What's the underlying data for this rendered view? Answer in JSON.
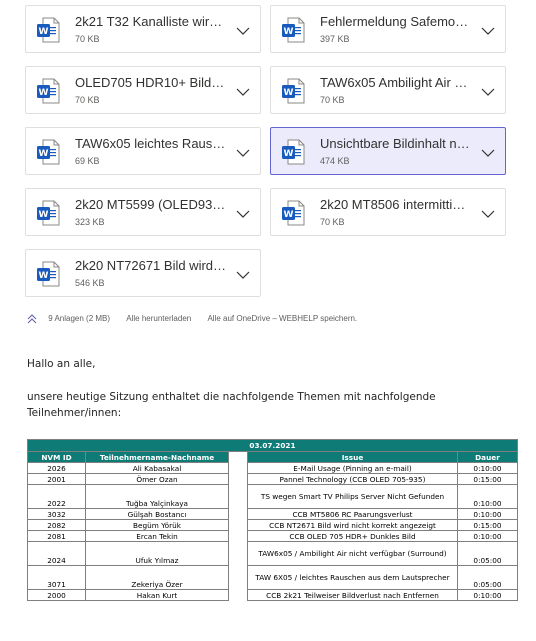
{
  "attachments": [
    {
      "name": "2k21 T32 Kanalliste wird …",
      "size": "70 KB",
      "selected": false
    },
    {
      "name": "Fehlermeldung Safemod…",
      "size": "397 KB",
      "selected": false
    },
    {
      "name": "OLED705 HDR10+ Bildin…",
      "size": "70 KB",
      "selected": false
    },
    {
      "name": "TAW6x05 Ambilight Air n…",
      "size": "70 KB",
      "selected": false
    },
    {
      "name": "TAW6x05 leichtes Rausc…",
      "size": "69 KB",
      "selected": false
    },
    {
      "name": "Unsichtbare Bildinhalt na…",
      "size": "474 KB",
      "selected": true
    },
    {
      "name": "2k20 MT5599 (OLED935)…",
      "size": "323 KB",
      "selected": false
    },
    {
      "name": "2k20 MT8506 intermittie…",
      "size": "70 KB",
      "selected": false
    },
    {
      "name": "2k20 NT72671 Bild wird …",
      "size": "546 KB",
      "selected": false
    }
  ],
  "attachment_bar": {
    "count_label": "9 Anlagen (2 MB)",
    "download_all": "Alle herunterladen",
    "save_onedrive": "Alle auf OneDrive – WEBHELP speichern."
  },
  "message": {
    "greeting": "Hallo an alle,",
    "line1": "unsere heutige Sitzung enthaltet die nachfolgende Themen mit nachfolgende",
    "line2": "Teilnehmer/innen:"
  },
  "table": {
    "date": "03.07.2021",
    "headers": {
      "id": "NVM ID",
      "name": "Teilnehmername-Nachname",
      "issue": "Issue",
      "duration": "Dauer"
    },
    "rows": [
      {
        "id": "2026",
        "name": "Ali Kabasakal",
        "issue": "E-Mail Usage (Pinning an e-mail)",
        "duration": "0:10:00"
      },
      {
        "id": "2001",
        "name": "Ömer Ozan",
        "issue": "Pannel Technology (CCB OLED 705-935)",
        "duration": "0:15:00"
      },
      {
        "id": "2022",
        "name": "Tuğba Yalçinkaya",
        "issue": "TS wegen Smart TV Philips Server Nicht Gefunden",
        "duration": "0:10:00"
      },
      {
        "id": "3032",
        "name": "Gülşah Bostancı",
        "issue": "CCB MT5806 RC Paarungsverlust",
        "duration": "0:10:00"
      },
      {
        "id": "2082",
        "name": "Begüm Yörük",
        "issue": "CCB NT2671 Bild wird nicht korrekt angezeigt",
        "duration": "0:15:00"
      },
      {
        "id": "2081",
        "name": "Ercan Tekin",
        "issue": "CCB OLED 705 HDR+ Dunkles Bild",
        "duration": "0:10:00"
      },
      {
        "id": "2024",
        "name": "Ufuk Yılmaz",
        "issue": "TAW6x05 / Ambilight Air nicht verfügbar (Surround)",
        "duration": "0:05:00"
      },
      {
        "id": "3071",
        "name": "Zekeriya Özer",
        "issue": "TAW 6X05 / leichtes Rauschen aus dem Lautsprecher",
        "duration": "0:05:00"
      },
      {
        "id": "2000",
        "name": "Hakan Kurt",
        "issue": "CCB 2k21 Teilweiser Bildverlust nach Entfernen",
        "duration": "0:10:00"
      }
    ]
  },
  "colors": {
    "table_header": "#0f7b76",
    "word_blue": "#185abd",
    "selected_bg": "#ebebfb",
    "selected_border": "#6264d1"
  },
  "icons": {
    "attachment": "word-doc-icon",
    "expand": "chevron-down-icon",
    "collapse": "double-chevron-up-icon"
  }
}
